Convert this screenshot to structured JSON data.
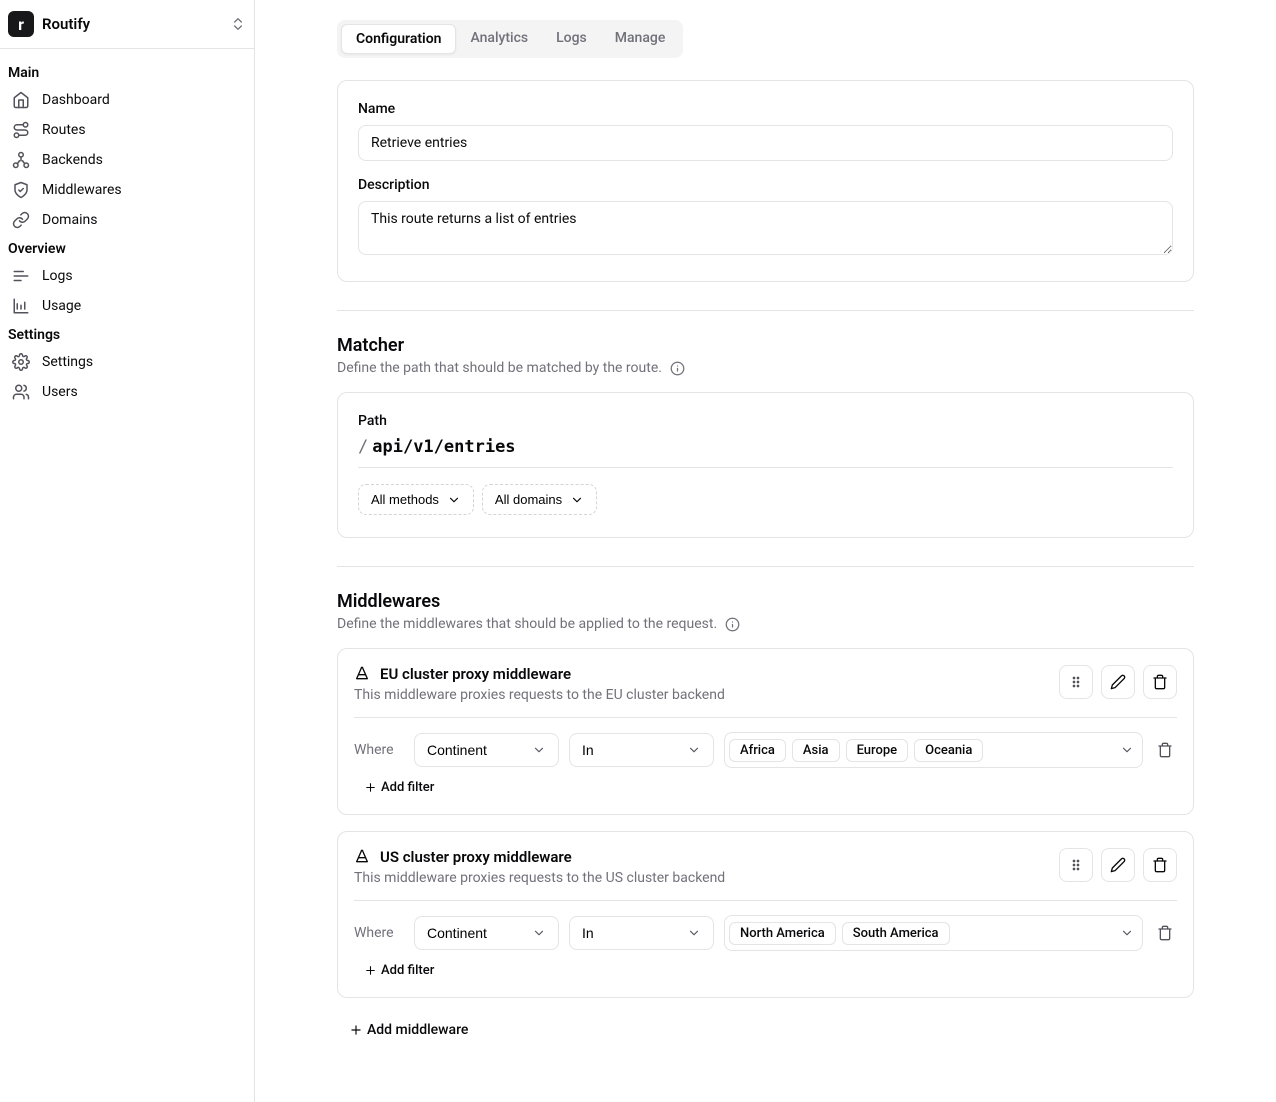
{
  "brand": {
    "name": "Routify",
    "logo_letter": "r"
  },
  "sidebar": {
    "sections": [
      {
        "title": "Main",
        "items": [
          {
            "label": "Dashboard",
            "icon": "home"
          },
          {
            "label": "Routes",
            "icon": "route"
          },
          {
            "label": "Backends",
            "icon": "backends"
          },
          {
            "label": "Middlewares",
            "icon": "shield"
          },
          {
            "label": "Domains",
            "icon": "link"
          }
        ]
      },
      {
        "title": "Overview",
        "items": [
          {
            "label": "Logs",
            "icon": "logs"
          },
          {
            "label": "Usage",
            "icon": "chart"
          }
        ]
      },
      {
        "title": "Settings",
        "items": [
          {
            "label": "Settings",
            "icon": "gear"
          },
          {
            "label": "Users",
            "icon": "users"
          }
        ]
      }
    ]
  },
  "tabs": [
    {
      "label": "Configuration",
      "active": true
    },
    {
      "label": "Analytics",
      "active": false
    },
    {
      "label": "Logs",
      "active": false
    },
    {
      "label": "Manage",
      "active": false
    }
  ],
  "form": {
    "name_label": "Name",
    "name_value": "Retrieve entries",
    "desc_label": "Description",
    "desc_value": "This route returns a list of entries"
  },
  "matcher": {
    "title": "Matcher",
    "desc": "Define the path that should be matched by the route.",
    "path_label": "Path",
    "path_value": "api/v1/entries",
    "methods_label": "All methods",
    "domains_label": "All domains"
  },
  "middlewares": {
    "title": "Middlewares",
    "desc": "Define the middlewares that should be applied to the request.",
    "add_label": "Add middleware",
    "items": [
      {
        "title": "EU cluster proxy middleware",
        "desc": "This middleware proxies requests to the EU cluster backend",
        "where": "Where",
        "field": "Continent",
        "op": "In",
        "tags": [
          "Africa",
          "Asia",
          "Europe",
          "Oceania"
        ],
        "add_filter": "Add filter"
      },
      {
        "title": "US cluster proxy middleware",
        "desc": "This middleware proxies requests to the US cluster backend",
        "where": "Where",
        "field": "Continent",
        "op": "In",
        "tags": [
          "North America",
          "South America"
        ],
        "add_filter": "Add filter"
      }
    ]
  }
}
